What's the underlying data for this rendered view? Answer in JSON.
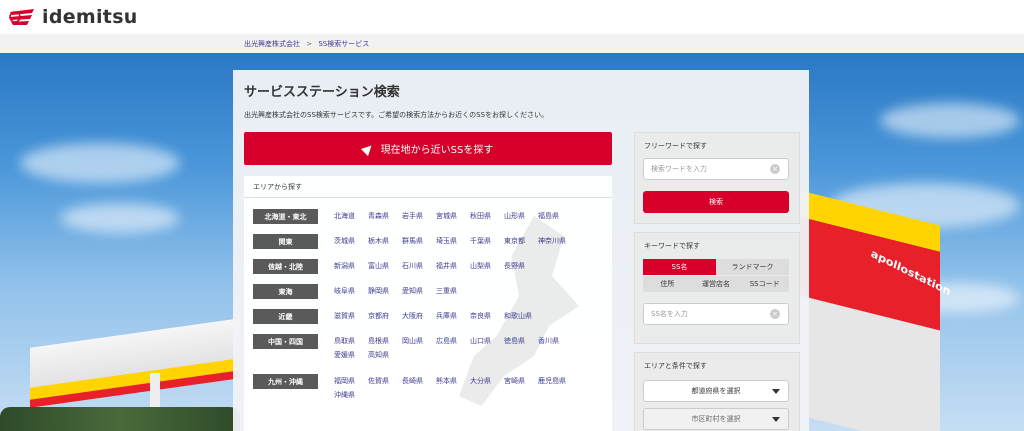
{
  "brand": {
    "logo_text": "idemitsu",
    "icon": "idemitsu-logo-icon",
    "accent": "#d6002a"
  },
  "breadcrumb": {
    "home": "出光興産株式会社",
    "separator": ">",
    "current": "SS検索サービス"
  },
  "background": {
    "station_brand": "apollostation"
  },
  "main": {
    "title": "サービスステーション検索",
    "description": "出光興産株式会社のSS検索サービスです。ご希望の検索方法からお近くのSSをお探しください。",
    "near_button": {
      "label": "現在地から近いSSを探す",
      "icon": "location-arrow-icon"
    }
  },
  "area": {
    "heading": "エリアから探す",
    "regions": [
      {
        "label": "北海道・東北",
        "prefs": [
          "北海道",
          "青森県",
          "岩手県",
          "宮城県",
          "秋田県",
          "山形県",
          "福島県"
        ]
      },
      {
        "label": "関東",
        "prefs": [
          "茨城県",
          "栃木県",
          "群馬県",
          "埼玉県",
          "千葉県",
          "東京都",
          "神奈川県"
        ]
      },
      {
        "label": "信越・北陸",
        "prefs": [
          "新潟県",
          "富山県",
          "石川県",
          "福井県",
          "山梨県",
          "長野県"
        ]
      },
      {
        "label": "東海",
        "prefs": [
          "岐阜県",
          "静岡県",
          "愛知県",
          "三重県"
        ]
      },
      {
        "label": "近畿",
        "prefs": [
          "滋賀県",
          "京都府",
          "大阪府",
          "兵庫県",
          "奈良県",
          "和歌山県"
        ]
      },
      {
        "label": "中国・四国",
        "prefs": [
          "鳥取県",
          "島根県",
          "岡山県",
          "広島県",
          "山口県",
          "徳島県",
          "香川県",
          "愛媛県",
          "高知県"
        ]
      },
      {
        "label": "九州・沖縄",
        "prefs": [
          "福岡県",
          "佐賀県",
          "長崎県",
          "熊本県",
          "大分県",
          "宮崎県",
          "鹿児島県",
          "沖縄県"
        ]
      }
    ]
  },
  "freeword": {
    "heading": "フリーワードで探す",
    "placeholder": "検索ワードを入力",
    "button": "検索",
    "clear_icon": "clear-icon"
  },
  "keyword": {
    "heading": "キーワードで探す",
    "tabs": [
      "SS名",
      "ランドマーク"
    ],
    "subtabs": [
      "住所",
      "運営店名",
      "SSコード"
    ],
    "placeholder": "SS名を入力"
  },
  "conditions": {
    "heading": "エリアと条件で探す",
    "pref_select": "都道府県を選択",
    "city_select": "市区町村を選択"
  }
}
